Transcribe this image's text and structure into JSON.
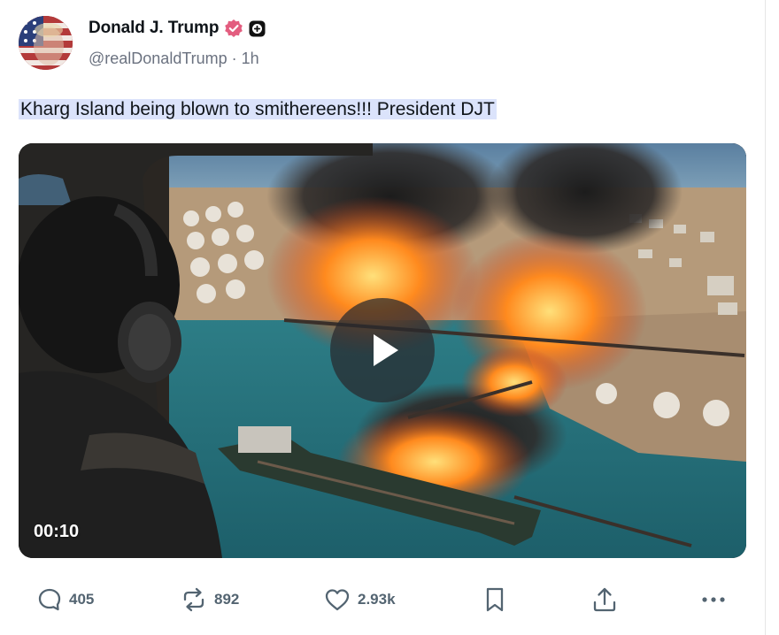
{
  "post": {
    "author_name": "Donald J. Trump",
    "handle": "@realDonaldTrump",
    "separator": "·",
    "timestamp": "1h",
    "text": "Kharg Island being blown to smithereens!!! President DJT"
  },
  "media": {
    "duration": "00:10",
    "play_icon": "play-icon"
  },
  "actions": {
    "replies": "405",
    "reposts": "892",
    "likes": "2.93k"
  },
  "colors": {
    "verified_badge": "#e35d7f",
    "highlight": "#dbe3fb",
    "muted_text": "#536471"
  }
}
